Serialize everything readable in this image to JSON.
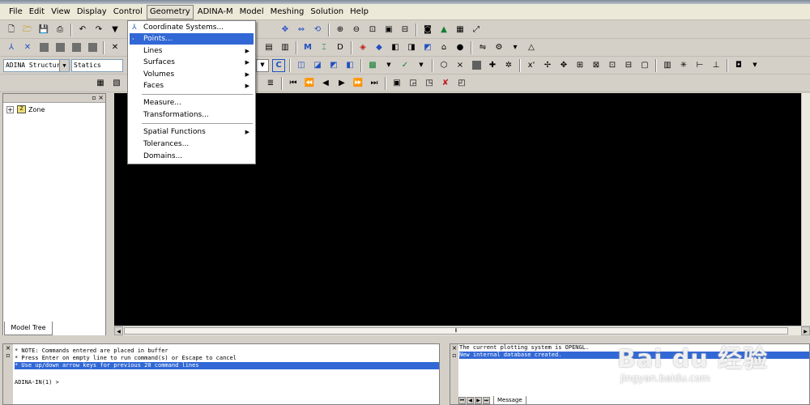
{
  "menubar": {
    "items": [
      "File",
      "Edit",
      "View",
      "Display",
      "Control",
      "Geometry",
      "ADINA-M",
      "Model",
      "Meshing",
      "Solution",
      "Help"
    ],
    "active": "Geometry"
  },
  "geometry_menu": {
    "items": [
      {
        "label": "Coordinate Systems...",
        "submenu": false,
        "icon": "coord-system-icon"
      },
      {
        "label": "Points...",
        "submenu": false,
        "icon": "points-icon",
        "highlighted": true
      },
      {
        "label": "Lines",
        "submenu": true
      },
      {
        "label": "Surfaces",
        "submenu": true
      },
      {
        "label": "Volumes",
        "submenu": true
      },
      {
        "label": "Faces",
        "submenu": true
      },
      {
        "label": "Measure...",
        "submenu": false
      },
      {
        "label": "Transformations...",
        "submenu": false
      },
      {
        "label": "Spatial Functions",
        "submenu": true
      },
      {
        "label": "Tolerances...",
        "submenu": false
      },
      {
        "label": "Domains...",
        "submenu": false
      }
    ]
  },
  "toolbar": {
    "program_select": "ADINA Structure",
    "analysis_select": "Statics"
  },
  "model_tree": {
    "root_label": "Zone",
    "tab_label": "Model Tree"
  },
  "command_window": {
    "lines": [
      "* NOTE: Commands entered are placed in buffer",
      "* Press Enter on empty line to run command(s) or Escape to cancel",
      "* Use up/down arrow keys for previous 20 command lines"
    ],
    "prompt": "ADINA-IN(1) >"
  },
  "message_window": {
    "lines": [
      "The current plotting system is OPENGL.",
      "New internal database created."
    ],
    "tab_label": "Message"
  },
  "watermark": {
    "main": "Bai du 经验",
    "sub": "jingyan.baidu.com"
  },
  "colors": {
    "selection": "#3168d5",
    "viewport": "#000000",
    "chrome": "#d4d0c8"
  }
}
